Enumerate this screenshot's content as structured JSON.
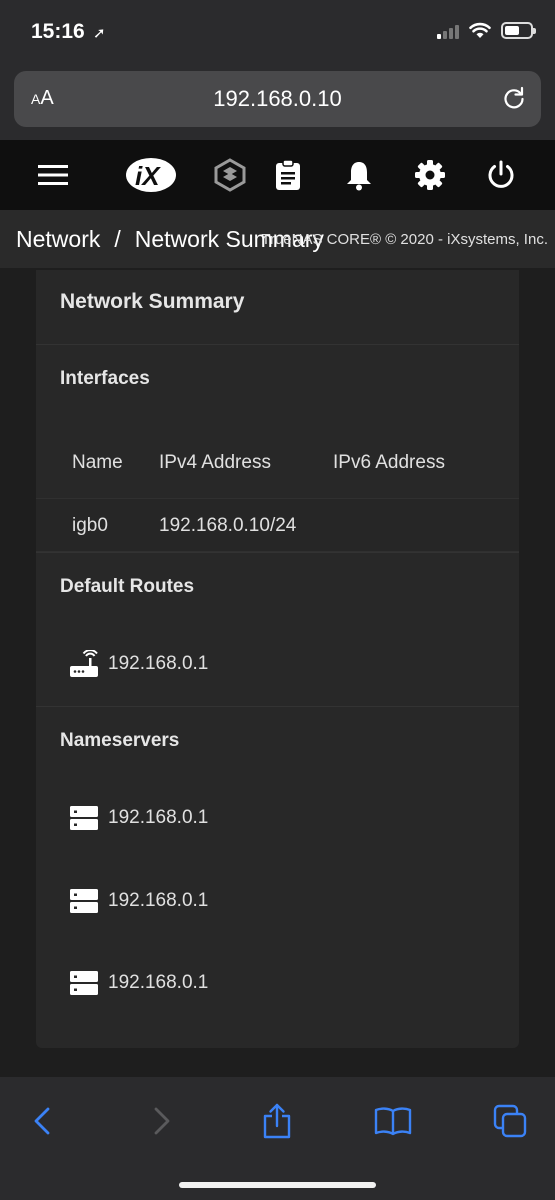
{
  "status_bar": {
    "time": "15:16"
  },
  "url_bar": {
    "aa_small": "A",
    "aa_large": "A",
    "url": "192.168.0.10"
  },
  "topbar": {
    "icons": [
      "menu-icon",
      "ix-logo",
      "truenas-icon",
      "clipboard-icon",
      "bell-icon",
      "gear-icon",
      "power-icon"
    ]
  },
  "breadcrumb": {
    "parent": "Network",
    "separator": "/",
    "current": "Network Summary",
    "copyright": "TrueNAS CORE® © 2020 - iXsystems, Inc."
  },
  "card": {
    "title": "Network Summary",
    "interfaces": {
      "title": "Interfaces",
      "columns": [
        "Name",
        "IPv4 Address",
        "IPv6 Address"
      ],
      "rows": [
        {
          "name": "igb0",
          "ipv4": "192.168.0.10/24",
          "ipv6": ""
        }
      ]
    },
    "default_routes": {
      "title": "Default Routes",
      "items": [
        "192.168.0.1"
      ]
    },
    "nameservers": {
      "title": "Nameservers",
      "items": [
        "192.168.0.1",
        "192.168.0.1",
        "192.168.0.1"
      ]
    }
  },
  "colors": {
    "safari_blue": "#3b82f6",
    "background": "#1e1e1e",
    "topbar": "#0f0f0f"
  }
}
